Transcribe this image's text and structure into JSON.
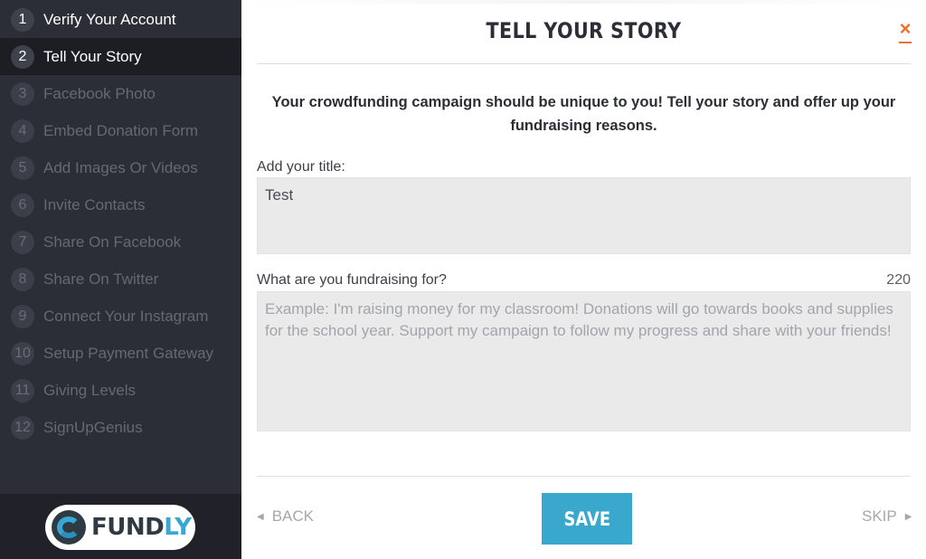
{
  "sidebar": {
    "steps": [
      {
        "num": "1",
        "label": "Verify Your Account",
        "state": "done"
      },
      {
        "num": "2",
        "label": "Tell Your Story",
        "state": "active"
      },
      {
        "num": "3",
        "label": "Facebook Photo",
        "state": "pending"
      },
      {
        "num": "4",
        "label": "Embed Donation Form",
        "state": "pending"
      },
      {
        "num": "5",
        "label": "Add Images Or Videos",
        "state": "pending"
      },
      {
        "num": "6",
        "label": "Invite Contacts",
        "state": "pending"
      },
      {
        "num": "7",
        "label": "Share On Facebook",
        "state": "pending"
      },
      {
        "num": "8",
        "label": "Share On Twitter",
        "state": "pending"
      },
      {
        "num": "9",
        "label": "Connect Your Instagram",
        "state": "pending"
      },
      {
        "num": "10",
        "label": "Setup Payment Gateway",
        "state": "pending"
      },
      {
        "num": "11",
        "label": "Giving Levels",
        "state": "pending"
      },
      {
        "num": "12",
        "label": "SignUpGenius",
        "state": "pending"
      }
    ],
    "logo": {
      "text_main": "FUND",
      "text_accent": "LY",
      "icon": "fundly-logo-icon"
    }
  },
  "modal": {
    "title": "TELL YOUR STORY",
    "close_label": "×",
    "intro": "Your crowdfunding campaign should be unique to you! Tell your story and offer up your fundraising reasons.",
    "title_field": {
      "label": "Add your title:",
      "value": "Test"
    },
    "reason_field": {
      "label": "What are you fundraising for?",
      "char_count": "220",
      "value": "",
      "placeholder": "Example: I'm raising money for my classroom! Donations will go towards books and supplies for the school year. Support my campaign to follow my progress and share with your friends!"
    },
    "footer": {
      "back_label": "BACK",
      "save_label": "SAVE",
      "skip_label": "SKIP",
      "back_icon": "caret-left-icon",
      "skip_icon": "caret-right-icon"
    }
  },
  "colors": {
    "sidebar_bg": "#2b2d37",
    "sidebar_active_bg": "#1d1e24",
    "accent_blue": "#3aa8cc",
    "close_orange": "#e8742a",
    "input_bg": "#eaeaea"
  }
}
